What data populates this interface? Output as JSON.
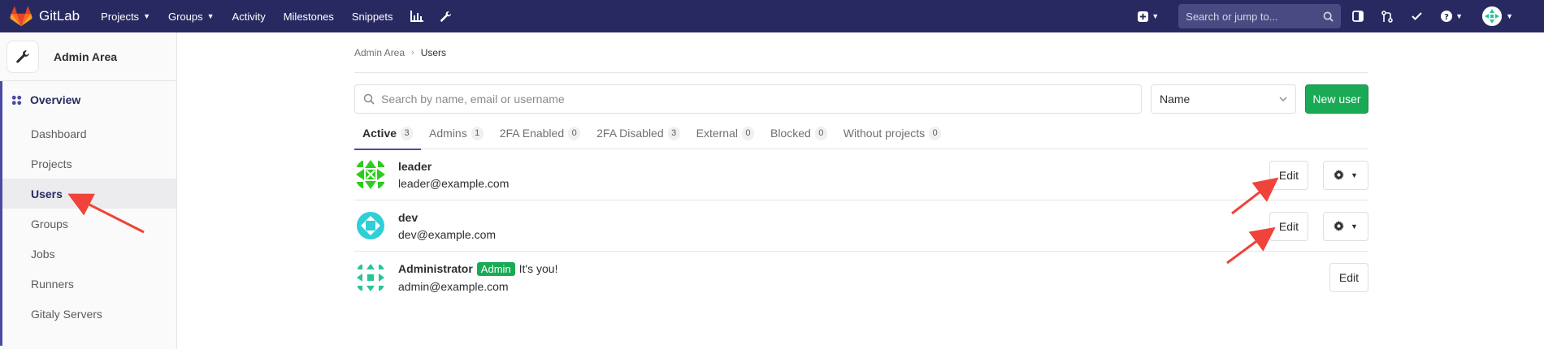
{
  "navbar": {
    "brand": "GitLab",
    "links": [
      {
        "label": "Projects",
        "has_caret": true
      },
      {
        "label": "Groups",
        "has_caret": true
      },
      {
        "label": "Activity",
        "has_caret": false
      },
      {
        "label": "Milestones",
        "has_caret": false
      },
      {
        "label": "Snippets",
        "has_caret": false
      }
    ],
    "search_placeholder": "Search or jump to...",
    "icons": [
      "chart-icon",
      "wrench-icon",
      "plus-icon",
      "search-icon",
      "sidebar-icon",
      "merge-request-icon",
      "todo-icon",
      "help-icon",
      "user-avatar"
    ]
  },
  "sidebar": {
    "title": "Admin Area",
    "section_label": "Overview",
    "items": [
      {
        "label": "Dashboard",
        "active": false
      },
      {
        "label": "Projects",
        "active": false
      },
      {
        "label": "Users",
        "active": true
      },
      {
        "label": "Groups",
        "active": false
      },
      {
        "label": "Jobs",
        "active": false
      },
      {
        "label": "Runners",
        "active": false
      },
      {
        "label": "Gitaly Servers",
        "active": false
      }
    ]
  },
  "breadcrumb": {
    "parent": "Admin Area",
    "current": "Users"
  },
  "filters": {
    "search_placeholder": "Search by name, email or username",
    "sort_value": "Name",
    "new_user_label": "New user"
  },
  "tabs": [
    {
      "label": "Active",
      "count": "3",
      "active": true
    },
    {
      "label": "Admins",
      "count": "1",
      "active": false
    },
    {
      "label": "2FA Enabled",
      "count": "0",
      "active": false
    },
    {
      "label": "2FA Disabled",
      "count": "3",
      "active": false
    },
    {
      "label": "External",
      "count": "0",
      "active": false
    },
    {
      "label": "Blocked",
      "count": "0",
      "active": false
    },
    {
      "label": "Without projects",
      "count": "0",
      "active": false
    }
  ],
  "users": [
    {
      "name": "leader",
      "email": "leader@example.com",
      "badge": "",
      "note": "",
      "edit_label": "Edit",
      "has_gear": true,
      "avatar_color": "#2ecc1f"
    },
    {
      "name": "dev",
      "email": "dev@example.com",
      "badge": "",
      "note": "",
      "edit_label": "Edit",
      "has_gear": true,
      "avatar_color": "#2ecfd6"
    },
    {
      "name": "Administrator",
      "email": "admin@example.com",
      "badge": "Admin",
      "note": "It's you!",
      "edit_label": "Edit",
      "has_gear": false,
      "avatar_color": "#27c49a"
    }
  ],
  "colors": {
    "navbar_bg": "#292961",
    "accent": "#4b4ba3",
    "success": "#1aaa55",
    "annotation_arrow": "#f0433a"
  }
}
